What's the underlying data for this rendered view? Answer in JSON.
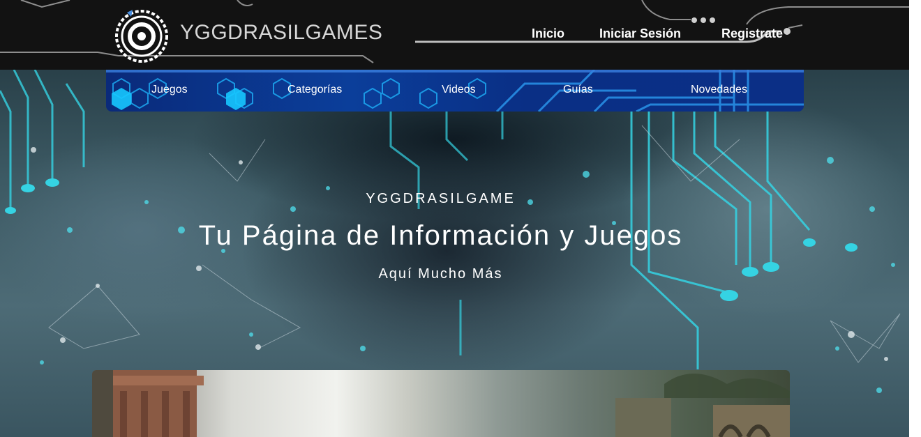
{
  "header": {
    "brand": "YGGDRASILGAMES",
    "nav": [
      {
        "label": "Inicio"
      },
      {
        "label": "Iniciar Sesión"
      },
      {
        "label": "Registrate"
      }
    ]
  },
  "subnav": {
    "items": [
      {
        "label": "Juegos"
      },
      {
        "label": "Categorías"
      },
      {
        "label": "Videos"
      },
      {
        "label": "Guías"
      },
      {
        "label": "Novedades"
      }
    ]
  },
  "hero": {
    "kicker": "YGGDRASILGAME",
    "title": "Tu Página de Información y Juegos",
    "subtitle": "Aquí Mucho Más"
  },
  "colors": {
    "header_bg": "#121212",
    "accent_cyan": "#2fd6e6",
    "subnav_blue": "#0b3e9a"
  }
}
